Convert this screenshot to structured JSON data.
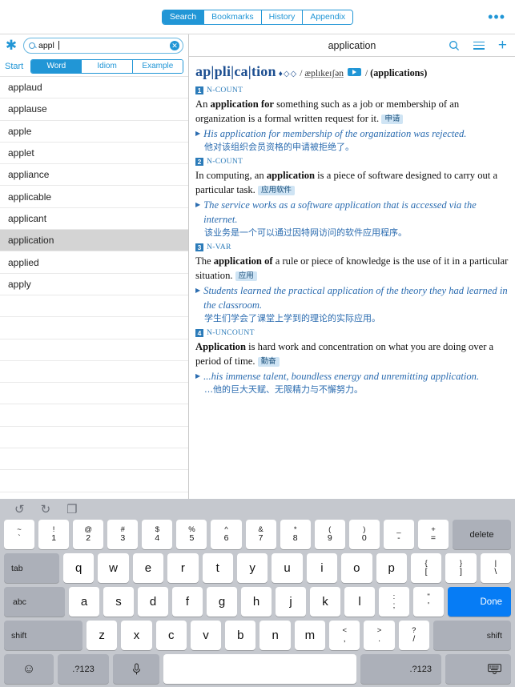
{
  "toolbar": {
    "tabs": [
      {
        "label": "Search",
        "active": true
      },
      {
        "label": "Bookmarks",
        "active": false
      },
      {
        "label": "History",
        "active": false
      },
      {
        "label": "Appendix",
        "active": false
      }
    ],
    "more_label": "•••"
  },
  "search": {
    "star_icon": "star-asterisk-icon",
    "value": "appl",
    "clear_label": "✕",
    "start_label": "Start",
    "filters": [
      {
        "label": "Word",
        "active": true
      },
      {
        "label": "Idiom",
        "active": false
      },
      {
        "label": "Example",
        "active": false
      }
    ]
  },
  "word_list": {
    "items": [
      {
        "label": "applaud",
        "selected": false
      },
      {
        "label": "applause",
        "selected": false
      },
      {
        "label": "apple",
        "selected": false
      },
      {
        "label": "applet",
        "selected": false
      },
      {
        "label": "appliance",
        "selected": false
      },
      {
        "label": "applicable",
        "selected": false
      },
      {
        "label": "applicant",
        "selected": false
      },
      {
        "label": "application",
        "selected": true
      },
      {
        "label": "applied",
        "selected": false
      },
      {
        "label": "apply",
        "selected": false
      }
    ]
  },
  "entry": {
    "header_title": "application",
    "search_icon": "search-icon",
    "menu_icon": "hamburger-menu-icon",
    "add_icon": "plus-icon",
    "headword": "ap|pli|ca|tion",
    "frequency": "♦◇◇",
    "phonetic_open": "/",
    "phonetic": "æplɪkeɪʃən",
    "speaker_icon": "audio-play-icon",
    "phonetic_close": "/",
    "inflections": "(applications)",
    "senses": [
      {
        "num": "1",
        "pos": "N-COUNT",
        "def_pre": "An ",
        "def_bold": "application for",
        "def_post": " something such as a job or membership of an organization is a formal written request for it.",
        "badge": "申请",
        "example": "His application for membership of the organization was rejected.",
        "translation": "他对该组织会员资格的申请被拒绝了。"
      },
      {
        "num": "2",
        "pos": "N-COUNT",
        "def_pre": "In computing, an ",
        "def_bold": "application",
        "def_post": " is a piece of software designed to carry out a particular task.",
        "badge": "应用软件",
        "example": "The service works as a software application that is accessed via the internet.",
        "translation": "该业务是一个可以通过因特网访问的软件应用程序。"
      },
      {
        "num": "3",
        "pos": "N-VAR",
        "def_pre": "The ",
        "def_bold": "application of",
        "def_post": " a rule or piece of knowledge is the use of it in a particular situation.",
        "badge": "应用",
        "example": "Students learned the practical application of the theory they had learned in the classroom.",
        "translation": "学生们学会了课堂上学到的理论的实际应用。"
      },
      {
        "num": "4",
        "pos": "N-UNCOUNT",
        "def_pre": "",
        "def_bold": "Application",
        "def_post": " is hard work and concentration on what you are doing over a period of time.",
        "badge": "勤奋",
        "example": "...his immense talent, boundless energy and unremitting application.",
        "translation": "…他的巨大天赋、无限精力与不懈努力。"
      }
    ]
  },
  "keyboard": {
    "tools": [
      {
        "icon": "undo-icon",
        "glyph": "↺"
      },
      {
        "icon": "redo-icon",
        "glyph": "↻"
      },
      {
        "icon": "paste-icon",
        "glyph": "❐"
      }
    ],
    "row_numbers": [
      {
        "up": "~",
        "lo": "`"
      },
      {
        "up": "!",
        "lo": "1"
      },
      {
        "up": "@",
        "lo": "2"
      },
      {
        "up": "#",
        "lo": "3"
      },
      {
        "up": "$",
        "lo": "4"
      },
      {
        "up": "%",
        "lo": "5"
      },
      {
        "up": "^",
        "lo": "6"
      },
      {
        "up": "&",
        "lo": "7"
      },
      {
        "up": "*",
        "lo": "8"
      },
      {
        "up": "(",
        "lo": "9"
      },
      {
        "up": ")",
        "lo": "0"
      },
      {
        "up": "_",
        "lo": "-"
      },
      {
        "up": "+",
        "lo": "="
      }
    ],
    "delete_label": "delete",
    "tab_label": "tab",
    "row_q": [
      {
        "label": "q"
      },
      {
        "label": "w"
      },
      {
        "label": "e"
      },
      {
        "label": "r"
      },
      {
        "label": "t"
      },
      {
        "label": "y"
      },
      {
        "label": "u"
      },
      {
        "label": "i"
      },
      {
        "label": "o"
      },
      {
        "label": "p"
      }
    ],
    "row_q_tail": [
      {
        "up": "{",
        "lo": "["
      },
      {
        "up": "}",
        "lo": "]"
      },
      {
        "up": "|",
        "lo": "\\"
      }
    ],
    "abc_label": "abc",
    "row_a": [
      {
        "label": "a"
      },
      {
        "label": "s"
      },
      {
        "label": "d"
      },
      {
        "label": "f"
      },
      {
        "label": "g"
      },
      {
        "label": "h"
      },
      {
        "label": "j"
      },
      {
        "label": "k"
      },
      {
        "label": "l"
      }
    ],
    "row_a_tail": [
      {
        "up": ":",
        "lo": ";"
      },
      {
        "up": "\"",
        "lo": "'"
      }
    ],
    "done_label": "Done",
    "shift_left_label": "shift",
    "row_z": [
      {
        "label": "z"
      },
      {
        "label": "x"
      },
      {
        "label": "c"
      },
      {
        "label": "v"
      },
      {
        "label": "b"
      },
      {
        "label": "n"
      },
      {
        "label": "m"
      }
    ],
    "row_z_tail": [
      {
        "up": "<",
        "lo": ","
      },
      {
        "up": ">",
        "lo": "."
      },
      {
        "up": "?",
        "lo": "/"
      }
    ],
    "shift_right_label": "shift",
    "emoji_label": "☺",
    "num_label": ".?123",
    "mic_label": "🎤",
    "space_label": "",
    "num2_label": ".?123",
    "dismiss_label": "⌨"
  },
  "colors": {
    "accent": "#2196d6",
    "sense_blue": "#2b7bb9",
    "headword_blue": "#1d4f91",
    "example_blue": "#2b6cb0",
    "selected_row": "#d4d4d4",
    "done_blue": "#067cf5",
    "keyboard_bg": "#c5c8ce"
  }
}
